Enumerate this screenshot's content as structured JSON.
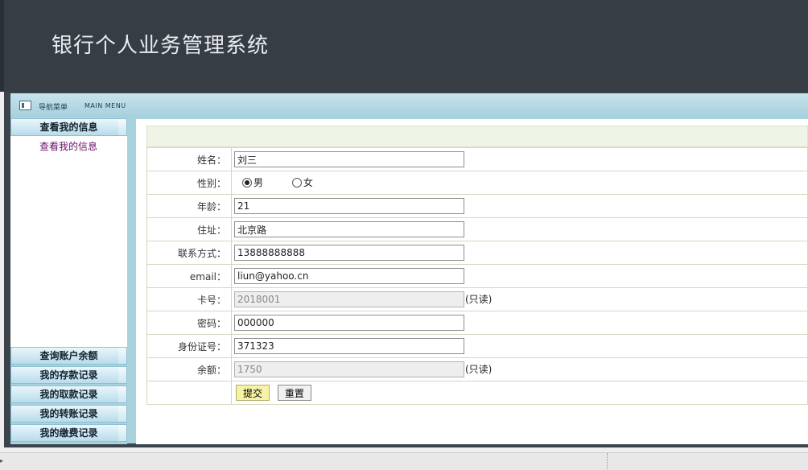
{
  "header": {
    "title": "银行个人业务管理系统"
  },
  "navbar": {
    "label": "导航菜单",
    "label_en": "MAIN MENU"
  },
  "sidebar": {
    "top_header": "查看我的信息",
    "links": [
      "查看我的信息"
    ],
    "bottom_headers": [
      "查询账户余额",
      "我的存款记录",
      "我的取款记录",
      "我的转账记录",
      "我的缴费记录"
    ]
  },
  "form": {
    "name_label": "姓名：",
    "name_value": "刘三",
    "gender_label": "性别：",
    "gender_options": [
      "男",
      "女"
    ],
    "gender_selected": "男",
    "age_label": "年龄：",
    "age_value": "21",
    "address_label": "住址：",
    "address_value": "北京路",
    "contact_label": "联系方式：",
    "contact_value": "13888888888",
    "email_label": "email：",
    "email_value": "liun@yahoo.cn",
    "card_label": "卡号：",
    "card_value": "2018001",
    "readonly_note": "(只读)",
    "password_label": "密码：",
    "password_value": "000000",
    "idcard_label": "身份证号：",
    "idcard_value": "371323",
    "balance_label": "余额：",
    "balance_value": "1750",
    "submit_label": "提交",
    "reset_label": "重置"
  },
  "colors": {
    "header_bg": "#363d45",
    "frame_bg": "#a9d2df",
    "submit_bg": "#f7f3a6"
  }
}
